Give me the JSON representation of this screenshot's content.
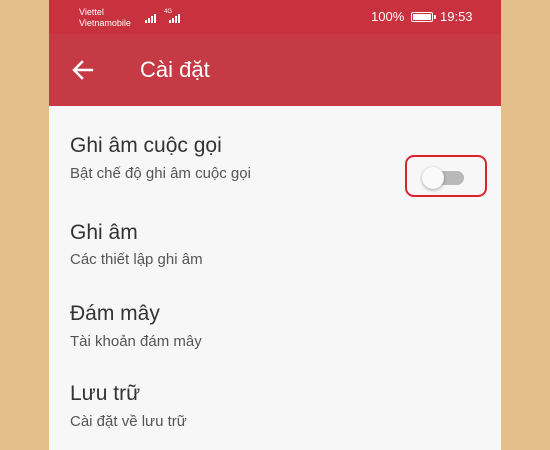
{
  "status_bar": {
    "carrier_1": "Viettel",
    "carrier_2": "Vietnamobile",
    "network_label": "4G",
    "battery_percent": "100%",
    "time": "19:53",
    "battery_level": 1.0
  },
  "app_bar": {
    "back_icon": "arrow-left-icon",
    "title": "Cài đặt"
  },
  "settings": {
    "items": [
      {
        "title": "Ghi âm cuộc gọi",
        "subtitle": "Bật chế độ ghi âm cuộc gọi",
        "toggle": {
          "on": false,
          "highlighted": true,
          "highlight_color": "#d9242f"
        }
      },
      {
        "title": "Ghi âm",
        "subtitle": "Các thiết lập ghi âm"
      },
      {
        "title": "Đám mây",
        "subtitle": "Tài khoản đám mây"
      },
      {
        "title": "Lưu trữ",
        "subtitle": "Cài đặt về lưu trữ"
      }
    ]
  },
  "colors": {
    "status_bar": "#c8313d",
    "app_bar": "#c53a45",
    "background": "#f7f7f7",
    "outer_background": "#e3bf8c",
    "toggle_track_off": "#b9b9b9"
  }
}
